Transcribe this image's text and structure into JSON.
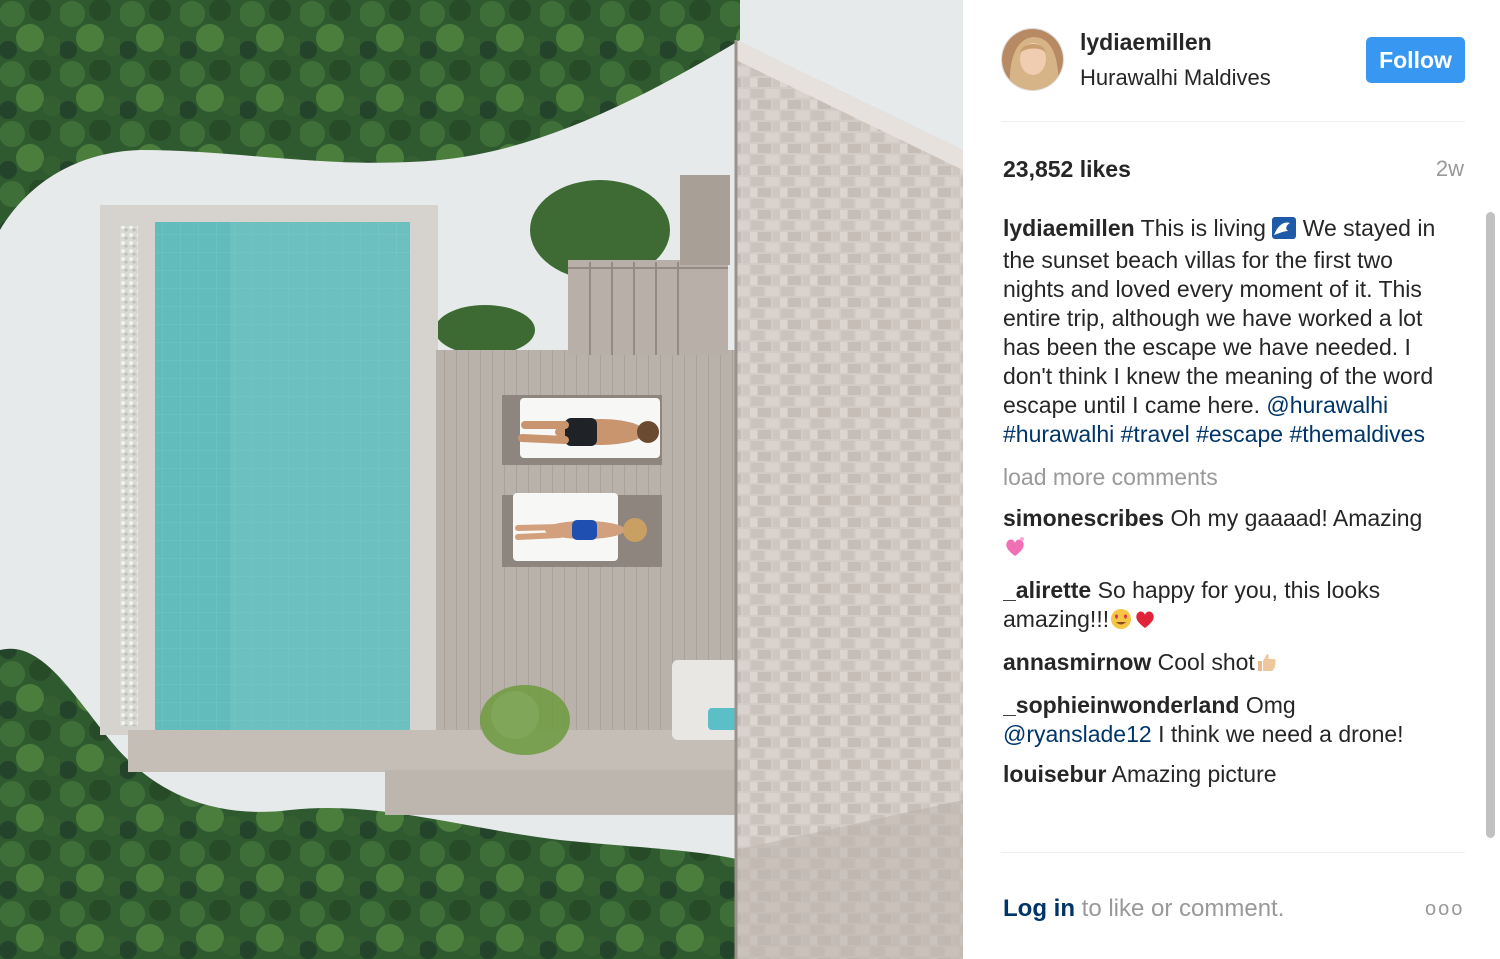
{
  "post": {
    "username": "lydiaemillen",
    "location": "Hurawalhi Maldives",
    "follow_label": "Follow",
    "likes": "23,852 likes",
    "time_ago": "2w",
    "caption": {
      "username": "lydiaemillen",
      "text": "This is living",
      "emoji": "wave-emoji",
      "body": "We stayed in the sunset beach villas for the first two nights and loved every moment of it. This entire trip, although we have worked a lot has been the escape we have needed. I don't think I knew the meaning of the word escape until I came here.",
      "tags": [
        "@hurawalhi",
        "#hurawalhi",
        "#travel",
        "#escape",
        "#themaldives"
      ]
    },
    "load_more": "load more comments",
    "comments": [
      {
        "user": "simonescribes",
        "text": "Oh my gaaaad! Amazing",
        "emoji": "sparkling-heart-emoji"
      },
      {
        "user": "_alirette",
        "text": "So happy for you, this looks amazing!!!",
        "emoji": "heart-eyes-and-red-heart-emoji"
      },
      {
        "user": "annasmirnow",
        "text": "Cool shot",
        "emoji": "thumbs-up-emoji"
      },
      {
        "user": "_sophieinwonderland",
        "text": "Omg",
        "mention": "@ryanslade12",
        "text2": "I think we need a drone!"
      },
      {
        "user": "louisebur",
        "text": "Amazing picture"
      }
    ],
    "footer": {
      "login_link": "Log in",
      "login_text": "to like or comment.",
      "more_label": "ooo"
    }
  },
  "colors": {
    "follow_blue": "#3897f0",
    "link_blue": "#003569",
    "muted_gray": "#999999",
    "pool_turquoise": "#5fb8b9",
    "foliage_green": "#2f5a2f",
    "sand": "#e6eaea",
    "deck_wood": "#b8b1a9",
    "roof_shingle": "#cfc7c1"
  }
}
